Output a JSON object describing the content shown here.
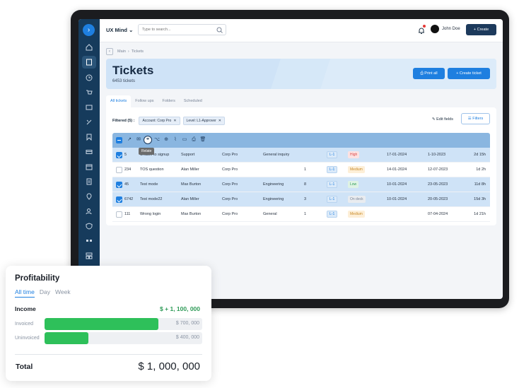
{
  "topbar": {
    "brand": "UX Mind",
    "search_placeholder": "Type to search...",
    "user_name": "John Doe",
    "create_label": "+ Create"
  },
  "breadcrumb": {
    "parent": "Main",
    "current": "Tickets"
  },
  "hero": {
    "title": "Tickets",
    "count": "6453 tickets",
    "print_label": "Print all",
    "create_ticket_label": "+ Create ticket"
  },
  "tabs": [
    "All tickets",
    "Follow ups",
    "Folders",
    "Scheduled"
  ],
  "filters": {
    "label": "Filtered (5) :",
    "chips": [
      "Account: Corp Pro",
      "Level: L1-Approver"
    ],
    "edit_fields_label": "Edit fields",
    "filters_label": "Filters"
  },
  "toolbar": {
    "tooltip": "Relate"
  },
  "rows": [
    {
      "selected": true,
      "id": "5",
      "title": "Unable to signup",
      "assignee": "Support",
      "account": "Corp Pro",
      "category": "General inquiry",
      "count": "",
      "level": "L-1",
      "priority": "High",
      "priority_kind": "high",
      "created": "17-01-2024",
      "due": "1-10-2023",
      "age": "2d 15h"
    },
    {
      "selected": false,
      "id": "234",
      "title": "TOS question",
      "assignee": "Alan Miller",
      "account": "Corp Pro",
      "category": "",
      "count": "1",
      "level": "L-1",
      "priority": "Medium",
      "priority_kind": "med",
      "created": "14-01-2024",
      "due": "12-07-2023",
      "age": "1d 2h"
    },
    {
      "selected": true,
      "id": "45",
      "title": "Test mode",
      "assignee": "Max Burton",
      "account": "Corp Pro",
      "category": "Engineering",
      "count": "8",
      "level": "L-1",
      "priority": "Low",
      "priority_kind": "low",
      "created": "10-01-2024",
      "due": "23-05-2023",
      "age": "11d 8h"
    },
    {
      "selected": true,
      "id": "6742",
      "title": "Test mode22",
      "assignee": "Alan Miller",
      "account": "Corp Pro",
      "category": "Engineering",
      "count": "3",
      "level": "L-1",
      "priority": "On deck",
      "priority_kind": "ondeck",
      "created": "10-01-2024",
      "due": "20-05-2023",
      "age": "15d 3h"
    },
    {
      "selected": false,
      "id": "111",
      "title": "Wrong login",
      "assignee": "Max Burton",
      "account": "Corp Pro",
      "category": "General",
      "count": "1",
      "level": "L-1",
      "priority": "Medium",
      "priority_kind": "med",
      "created": "",
      "due": "07-04-2024",
      "age": "1d 21h"
    }
  ],
  "profitability": {
    "title": "Profitability",
    "tabs": [
      "All time",
      "Day",
      "Week"
    ],
    "income_label": "Income",
    "income_value": "$ + 1, 100, 000",
    "invoiced_label": "Invoiced",
    "invoiced_value": "$ 700, 000",
    "invoiced_fraction": 0.72,
    "uninvoiced_label": "Uninvoiced",
    "uninvoiced_value": "$ 400, 000",
    "uninvoiced_fraction": 0.28,
    "total_label": "Total",
    "total_value": "$ 1, 000, 000"
  },
  "colors": {
    "accent": "#1e7fe0",
    "sidebar": "#163b5c",
    "success": "#2ec05a"
  }
}
